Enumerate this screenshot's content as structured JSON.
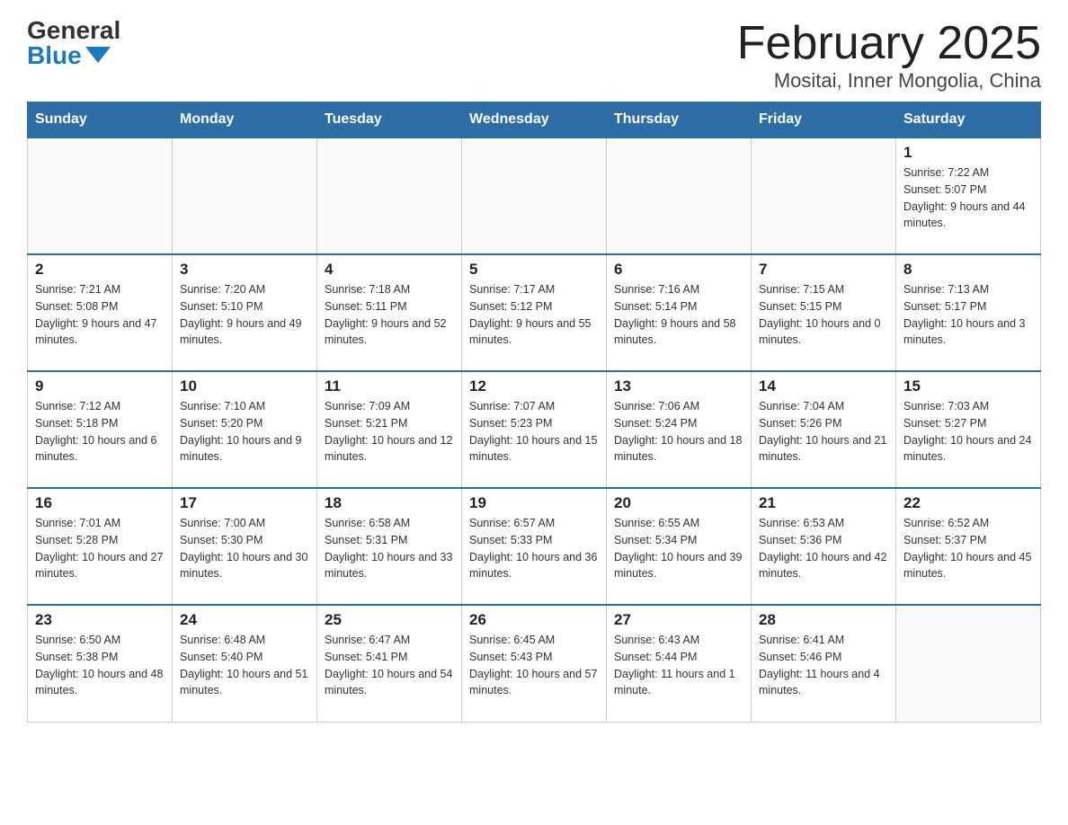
{
  "logo": {
    "general": "General",
    "blue": "Blue"
  },
  "title": "February 2025",
  "location": "Mositai, Inner Mongolia, China",
  "weekdays": [
    "Sunday",
    "Monday",
    "Tuesday",
    "Wednesday",
    "Thursday",
    "Friday",
    "Saturday"
  ],
  "weeks": [
    [
      {
        "day": "",
        "info": ""
      },
      {
        "day": "",
        "info": ""
      },
      {
        "day": "",
        "info": ""
      },
      {
        "day": "",
        "info": ""
      },
      {
        "day": "",
        "info": ""
      },
      {
        "day": "",
        "info": ""
      },
      {
        "day": "1",
        "info": "Sunrise: 7:22 AM\nSunset: 5:07 PM\nDaylight: 9 hours and 44 minutes."
      }
    ],
    [
      {
        "day": "2",
        "info": "Sunrise: 7:21 AM\nSunset: 5:08 PM\nDaylight: 9 hours and 47 minutes."
      },
      {
        "day": "3",
        "info": "Sunrise: 7:20 AM\nSunset: 5:10 PM\nDaylight: 9 hours and 49 minutes."
      },
      {
        "day": "4",
        "info": "Sunrise: 7:18 AM\nSunset: 5:11 PM\nDaylight: 9 hours and 52 minutes."
      },
      {
        "day": "5",
        "info": "Sunrise: 7:17 AM\nSunset: 5:12 PM\nDaylight: 9 hours and 55 minutes."
      },
      {
        "day": "6",
        "info": "Sunrise: 7:16 AM\nSunset: 5:14 PM\nDaylight: 9 hours and 58 minutes."
      },
      {
        "day": "7",
        "info": "Sunrise: 7:15 AM\nSunset: 5:15 PM\nDaylight: 10 hours and 0 minutes."
      },
      {
        "day": "8",
        "info": "Sunrise: 7:13 AM\nSunset: 5:17 PM\nDaylight: 10 hours and 3 minutes."
      }
    ],
    [
      {
        "day": "9",
        "info": "Sunrise: 7:12 AM\nSunset: 5:18 PM\nDaylight: 10 hours and 6 minutes."
      },
      {
        "day": "10",
        "info": "Sunrise: 7:10 AM\nSunset: 5:20 PM\nDaylight: 10 hours and 9 minutes."
      },
      {
        "day": "11",
        "info": "Sunrise: 7:09 AM\nSunset: 5:21 PM\nDaylight: 10 hours and 12 minutes."
      },
      {
        "day": "12",
        "info": "Sunrise: 7:07 AM\nSunset: 5:23 PM\nDaylight: 10 hours and 15 minutes."
      },
      {
        "day": "13",
        "info": "Sunrise: 7:06 AM\nSunset: 5:24 PM\nDaylight: 10 hours and 18 minutes."
      },
      {
        "day": "14",
        "info": "Sunrise: 7:04 AM\nSunset: 5:26 PM\nDaylight: 10 hours and 21 minutes."
      },
      {
        "day": "15",
        "info": "Sunrise: 7:03 AM\nSunset: 5:27 PM\nDaylight: 10 hours and 24 minutes."
      }
    ],
    [
      {
        "day": "16",
        "info": "Sunrise: 7:01 AM\nSunset: 5:28 PM\nDaylight: 10 hours and 27 minutes."
      },
      {
        "day": "17",
        "info": "Sunrise: 7:00 AM\nSunset: 5:30 PM\nDaylight: 10 hours and 30 minutes."
      },
      {
        "day": "18",
        "info": "Sunrise: 6:58 AM\nSunset: 5:31 PM\nDaylight: 10 hours and 33 minutes."
      },
      {
        "day": "19",
        "info": "Sunrise: 6:57 AM\nSunset: 5:33 PM\nDaylight: 10 hours and 36 minutes."
      },
      {
        "day": "20",
        "info": "Sunrise: 6:55 AM\nSunset: 5:34 PM\nDaylight: 10 hours and 39 minutes."
      },
      {
        "day": "21",
        "info": "Sunrise: 6:53 AM\nSunset: 5:36 PM\nDaylight: 10 hours and 42 minutes."
      },
      {
        "day": "22",
        "info": "Sunrise: 6:52 AM\nSunset: 5:37 PM\nDaylight: 10 hours and 45 minutes."
      }
    ],
    [
      {
        "day": "23",
        "info": "Sunrise: 6:50 AM\nSunset: 5:38 PM\nDaylight: 10 hours and 48 minutes."
      },
      {
        "day": "24",
        "info": "Sunrise: 6:48 AM\nSunset: 5:40 PM\nDaylight: 10 hours and 51 minutes."
      },
      {
        "day": "25",
        "info": "Sunrise: 6:47 AM\nSunset: 5:41 PM\nDaylight: 10 hours and 54 minutes."
      },
      {
        "day": "26",
        "info": "Sunrise: 6:45 AM\nSunset: 5:43 PM\nDaylight: 10 hours and 57 minutes."
      },
      {
        "day": "27",
        "info": "Sunrise: 6:43 AM\nSunset: 5:44 PM\nDaylight: 11 hours and 1 minute."
      },
      {
        "day": "28",
        "info": "Sunrise: 6:41 AM\nSunset: 5:46 PM\nDaylight: 11 hours and 4 minutes."
      },
      {
        "day": "",
        "info": ""
      }
    ]
  ]
}
